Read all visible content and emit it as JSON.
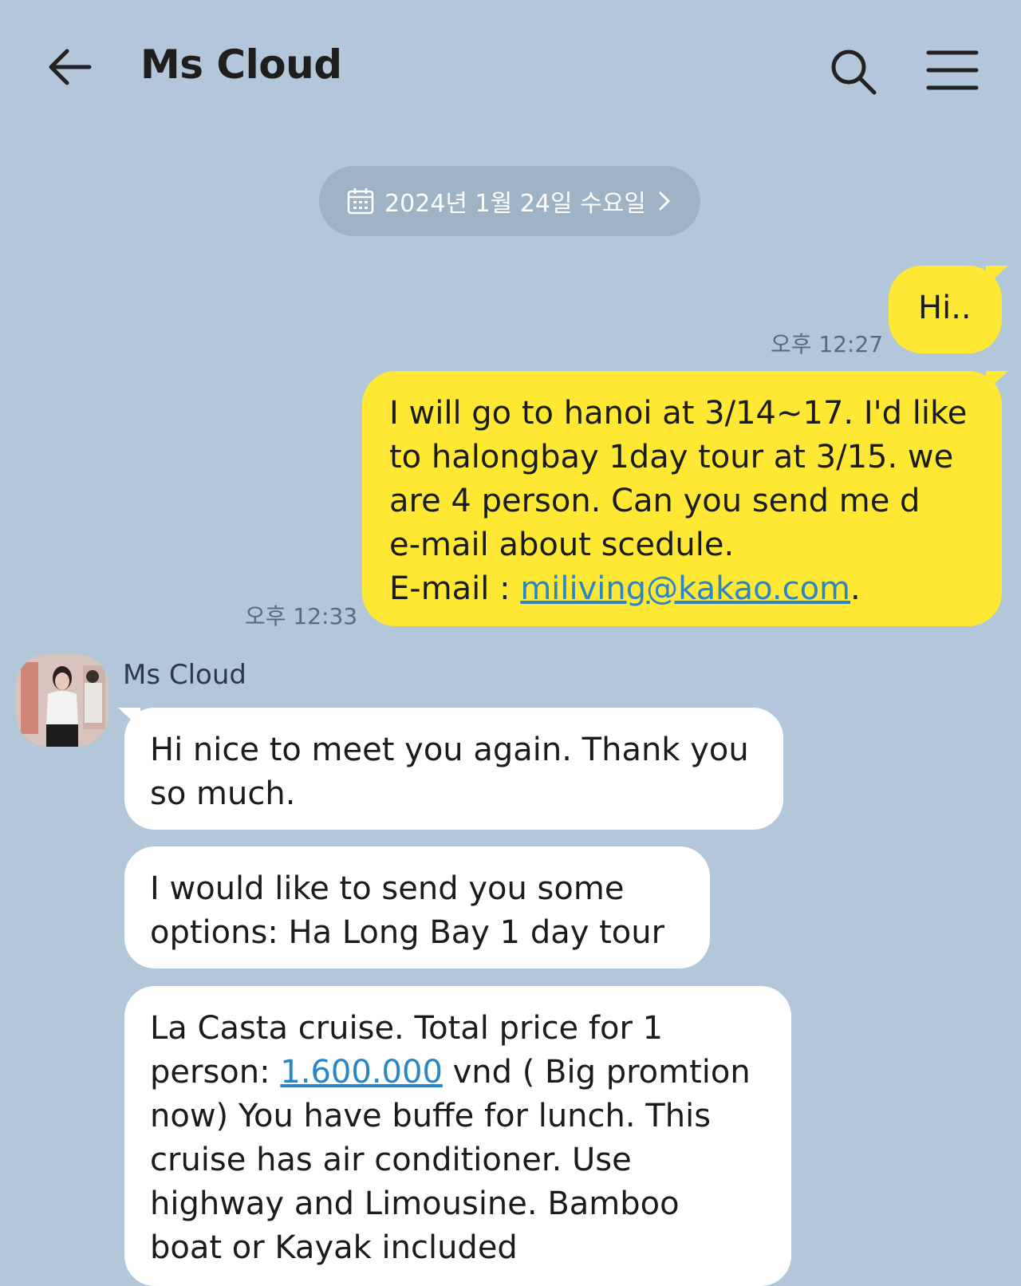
{
  "header": {
    "title": "Ms Cloud"
  },
  "date_divider": {
    "label": "2024년 1월 24일 수요일"
  },
  "messages": [
    {
      "text": "Hi..",
      "time": "오후 12:27"
    },
    {
      "text_before_link": "I will go to hanoi at 3/14~17. I'd like\nto halongbay 1day tour at 3/15. we\nare 4 person. Can you send me d\ne-mail about scedule.\nE-mail : ",
      "link": "miliving@kakao.com",
      "text_after_link": ".",
      "time": "오후 12:33"
    },
    {
      "text": "Hi nice to meet you again. Thank you\nso much."
    },
    {
      "text": "I would like to send you some\noptions:  Ha Long Bay 1 day tour"
    },
    {
      "text_before_link": "La Casta  cruise. Total price for 1\nperson: ",
      "link": "1.600.000",
      "text_after_link": "  vnd ( Big promtion\nnow)  You have buffe  for lunch. This\ncruise has  air conditioner. Use\nhighway and Limousine. Bamboo\nboat or Kayak included"
    }
  ],
  "sender": {
    "name": "Ms Cloud"
  }
}
